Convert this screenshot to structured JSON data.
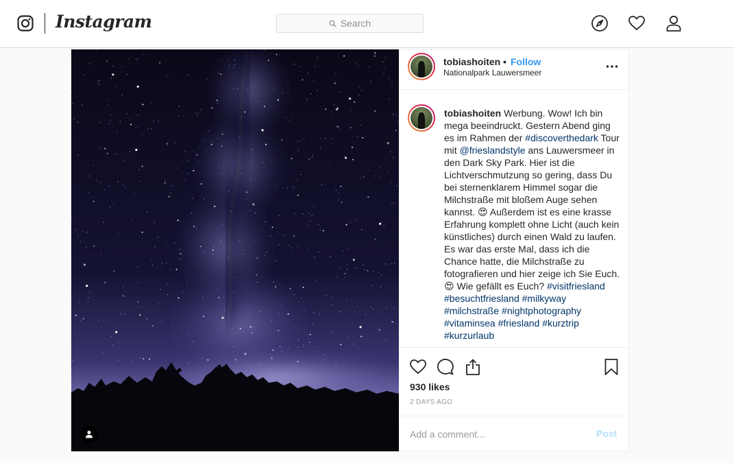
{
  "header": {
    "brand": "Instagram",
    "search_placeholder": "Search",
    "icons": [
      "instagram-glyph-icon",
      "compass-icon",
      "heart-icon",
      "user-icon"
    ]
  },
  "post": {
    "username": "tobiashoiten",
    "separator": "•",
    "follow_label": "Follow",
    "location": "Nationalpark Lauwersmeer",
    "caption": {
      "username": "tobiashoiten",
      "segments": [
        {
          "type": "text",
          "value": " Werbung. Wow! Ich bin mega beeindruckt. Gestern Abend ging es im Rahmen der "
        },
        {
          "type": "tag",
          "value": "#discoverthedark"
        },
        {
          "type": "text",
          "value": " Tour mit "
        },
        {
          "type": "tag",
          "value": "@frieslandstyle"
        },
        {
          "type": "text",
          "value": " ans Lauwersmeer in den Dark Sky Park. Hier ist die Lichtverschmutzung so gering, dass Du bei sternenklarem Himmel sogar die Milchstraße mit bloßem Auge sehen kannst. 😍 Außerdem ist es eine krasse Erfahrung komplett ohne Licht (auch kein künstliches) durch einen Wald zu laufen. Es war das erste Mal, dass ich die Chance hatte, die Milchstraße zu fotografieren und hier zeige ich Sie Euch. 😍 Wie gefällt es Euch? "
        },
        {
          "type": "tag",
          "value": "#visitfriesland"
        },
        {
          "type": "text",
          "value": " "
        },
        {
          "type": "tag",
          "value": "#besuchtfriesland"
        },
        {
          "type": "text",
          "value": " "
        },
        {
          "type": "tag",
          "value": "#milkyway"
        },
        {
          "type": "text",
          "value": " "
        },
        {
          "type": "tag",
          "value": "#milchstraße"
        },
        {
          "type": "text",
          "value": " "
        },
        {
          "type": "tag",
          "value": "#nightphotography"
        },
        {
          "type": "text",
          "value": " "
        },
        {
          "type": "tag",
          "value": "#vitaminsea"
        },
        {
          "type": "text",
          "value": " "
        },
        {
          "type": "tag",
          "value": "#friesland"
        },
        {
          "type": "text",
          "value": " "
        },
        {
          "type": "tag",
          "value": "#kurztrip"
        },
        {
          "type": "text",
          "value": " "
        },
        {
          "type": "tag",
          "value": "#kurzurlaub"
        }
      ]
    },
    "likes": "930 likes",
    "date": "2 DAYS AGO",
    "comment_placeholder": "Add a comment...",
    "post_label": "Post",
    "image_description_icon": "milky-way-photo"
  },
  "colors": {
    "link_blue": "#3897f0",
    "hashtag": "#003569",
    "post_disabled": "#b2dffc",
    "border": "#dbdbdb"
  }
}
